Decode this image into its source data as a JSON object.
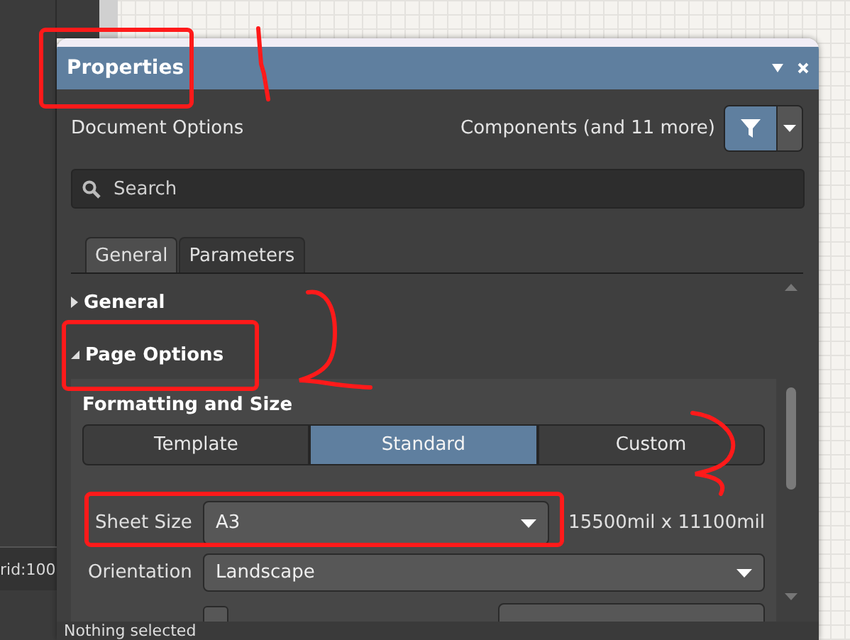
{
  "background": {
    "status_text": "rid:100"
  },
  "panel": {
    "title": "Properties"
  },
  "header": {
    "label": "Document Options",
    "filter_label": "Components (and 11 more)",
    "filter_active": true
  },
  "search": {
    "placeholder": "Search"
  },
  "tabs": [
    {
      "label": "General",
      "selected": true
    },
    {
      "label": "Parameters",
      "selected": false
    }
  ],
  "sections": [
    {
      "title": "General",
      "expanded": false
    },
    {
      "title": "Page Options",
      "expanded": true
    }
  ],
  "page_options": {
    "group_title": "Formatting and Size",
    "modes": [
      {
        "label": "Template",
        "selected": false
      },
      {
        "label": "Standard",
        "selected": true
      },
      {
        "label": "Custom",
        "selected": false
      }
    ],
    "fields": [
      {
        "label": "Sheet Size",
        "value": "A3",
        "reading": "15500mil x 11100mil"
      },
      {
        "label": "Orientation",
        "value": "Landscape"
      }
    ],
    "title_block": {
      "checked": false
    }
  },
  "status_bar": {
    "text": "Nothing selected"
  }
}
